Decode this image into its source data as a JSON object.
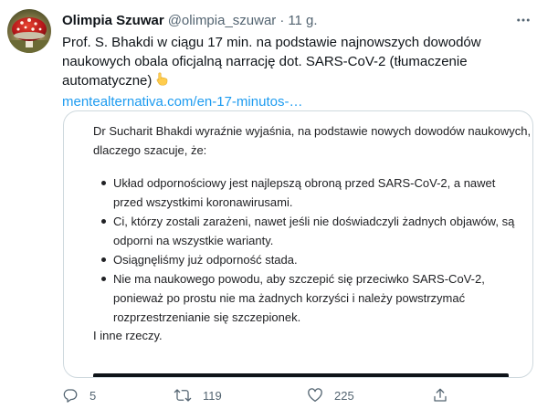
{
  "tweet": {
    "display_name": "Olimpia Szuwar",
    "handle": "@olimpia_szuwar",
    "separator": "·",
    "time": "11 g.",
    "text_lines": [
      "Prof. S. Bhakdi w ciągu 17 min. na podstawie najnowszych dowodów",
      "naukowych obala oficjalną narrację dot. SARS-CoV-2 (tłumaczenie",
      "automatyczne)"
    ],
    "emoji": "hand-pointing-down-icon",
    "link": "mentealternativa.com/en-17-minutos-…"
  },
  "card": {
    "intro_lines": [
      "Dr Sucharit Bhakdi wyraźnie wyjaśnia, na podstawie nowych dowodów naukowych,",
      "dlaczego szacuje, że:"
    ],
    "bullets": [
      {
        "lines": [
          "Układ odpornościowy jest najlepszą obroną przed SARS-CoV-2, a nawet",
          "przed wszystkimi koronawirusami."
        ]
      },
      {
        "lines": [
          "Ci, którzy zostali zarażeni, nawet jeśli nie doświadczyli żadnych objawów, są",
          "odporni na wszystkie warianty."
        ]
      },
      {
        "lines": [
          "Osiągnęliśmy już odporność stada."
        ]
      },
      {
        "lines": [
          "Nie ma naukowego powodu, aby szczepić się przeciwko SARS-CoV-2,",
          "ponieważ po prostu nie ma żadnych korzyści i należy powstrzymać",
          "rozprzestrzenianie się szczepionek."
        ]
      }
    ],
    "closing": "I inne rzeczy."
  },
  "actions": {
    "reply_count": "5",
    "retweet_count": "119",
    "like_count": "225"
  },
  "colors": {
    "link": "#1d9bf0",
    "muted": "#536471",
    "border": "#cfd9de",
    "emoji": "#ffcc4d"
  }
}
